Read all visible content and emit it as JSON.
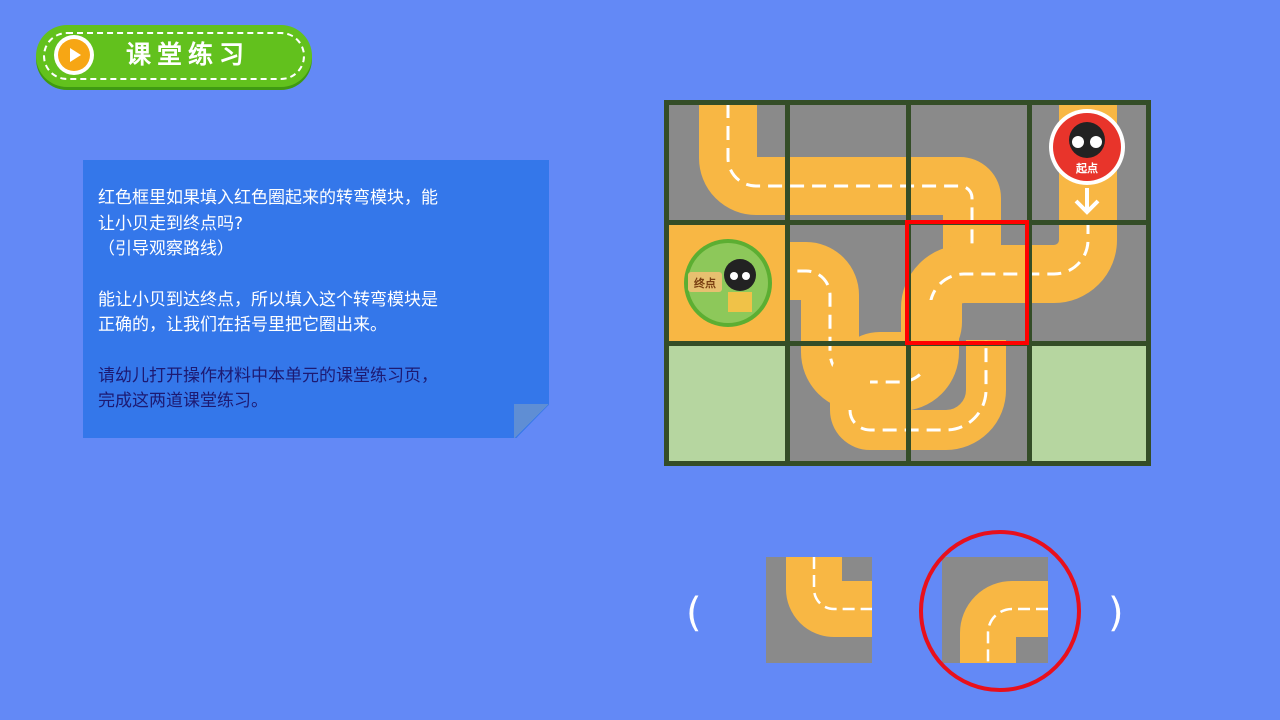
{
  "header": {
    "title": "课堂练习",
    "icon": "play-icon"
  },
  "card": {
    "lines": [
      "红色框里如果填入红色圈起来的转弯模块，能",
      "让小贝走到终点吗?",
      "（引导观察路线）",
      "能让小贝到达终点，所以填入这个转弯模块是",
      "正确的，让我们在括号里把它圈出来。",
      "请幼儿打开操作材料中本单元的课堂练习页，",
      "完成这两道课堂练习。"
    ]
  },
  "board": {
    "start_label": "起点",
    "end_label": "终点",
    "colors": {
      "road": "#f8b744",
      "ground": "#8a8a8a",
      "grass": "#b6d6a0",
      "grid": "#344d27",
      "highlight": "#ff0000"
    }
  },
  "answer": {
    "open_paren": "(",
    "close_paren": ")",
    "options": [
      "turn-tile-up-right",
      "turn-tile-down-right"
    ],
    "circled_option": 2
  }
}
